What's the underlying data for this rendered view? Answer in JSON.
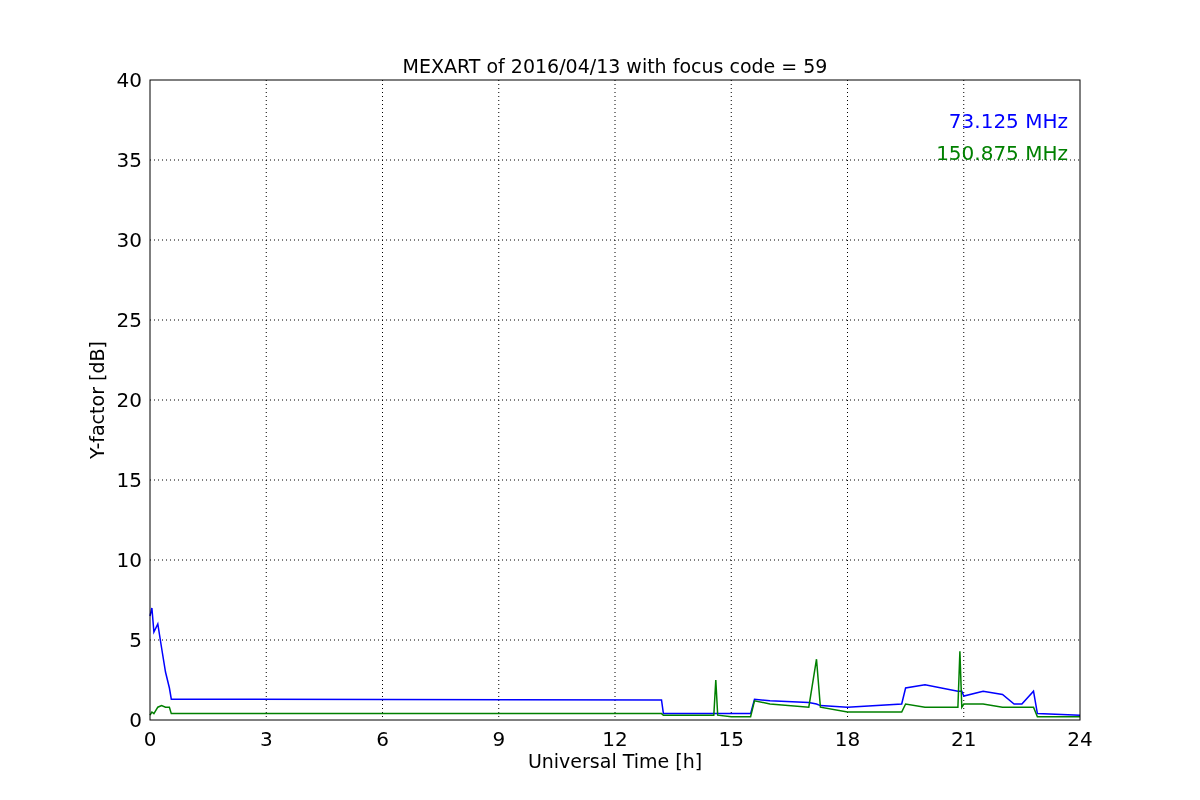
{
  "chart_data": {
    "type": "line",
    "title": "MEXART of 2016/04/13 with focus code = 59",
    "xlabel": "Universal Time [h]",
    "ylabel": "Y-factor [dB]",
    "x": [
      0,
      0.05,
      0.1,
      0.2,
      0.3,
      0.4,
      0.5,
      0.55,
      13.2,
      13.25,
      14,
      14.55,
      14.6,
      14.65,
      15,
      15.5,
      15.6,
      16,
      17,
      17.2,
      17.3,
      18,
      19.4,
      19.5,
      20,
      20.85,
      20.9,
      20.95,
      21,
      21.5,
      22,
      22.3,
      22.5,
      22.8,
      22.9,
      24
    ],
    "series": [
      {
        "name": "73.125 MHz",
        "color": "#0000ff",
        "values": [
          6.5,
          7,
          5.5,
          6,
          4.5,
          3,
          2,
          1.3,
          1.25,
          0.4,
          0.4,
          0.4,
          0.4,
          0.4,
          0.4,
          0.4,
          1.3,
          1.2,
          1.1,
          1,
          0.9,
          0.8,
          1.0,
          2.0,
          2.2,
          1.8,
          1.8,
          1.8,
          1.5,
          1.8,
          1.6,
          1.0,
          1.0,
          1.8,
          0.4,
          0.3
        ]
      },
      {
        "name": "150.875 MHz",
        "color": "#008000",
        "values": [
          0.3,
          0.5,
          0.4,
          0.8,
          0.9,
          0.8,
          0.8,
          0.4,
          0.4,
          0.3,
          0.3,
          0.3,
          2.5,
          0.3,
          0.2,
          0.2,
          1.2,
          1.0,
          0.8,
          3.8,
          0.8,
          0.5,
          0.5,
          1.0,
          0.8,
          0.8,
          4.3,
          0.8,
          1.0,
          1.0,
          0.8,
          0.8,
          0.8,
          0.8,
          0.2,
          0.2
        ]
      }
    ],
    "xlim": [
      0,
      24
    ],
    "ylim": [
      0,
      40
    ],
    "xticks": [
      0,
      3,
      6,
      9,
      12,
      15,
      18,
      21,
      24
    ],
    "yticks": [
      0,
      5,
      10,
      15,
      20,
      25,
      30,
      35,
      40
    ],
    "grid": true
  }
}
